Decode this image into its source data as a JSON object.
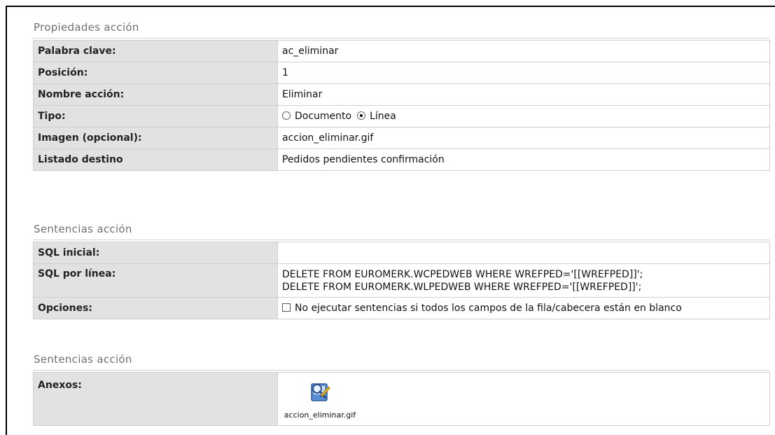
{
  "sections": {
    "properties_title": "Propiedades acción",
    "sentences_title": "Sentencias acción",
    "attachments_title": "Sentencias acción"
  },
  "properties": {
    "keyword_label": "Palabra clave:",
    "keyword_value": "ac_eliminar",
    "position_label": "Posición:",
    "position_value": "1",
    "name_label": "Nombre acción:",
    "name_value": "Eliminar",
    "type_label": "Tipo:",
    "type_option_document": "Documento",
    "type_option_line": "Línea",
    "type_selected": "Línea",
    "image_label": "Imagen (opcional):",
    "image_value": "accion_eliminar.gif",
    "target_label": "Listado destino",
    "target_value": "Pedidos pendientes confirmación"
  },
  "sentences": {
    "initial_label": "SQL inicial:",
    "initial_value": "",
    "per_line_label": "SQL por línea:",
    "per_line_value_1": "DELETE FROM EUROMERK.WCPEDWEB WHERE WREFPED='[[WREFPED]]';",
    "per_line_value_2": "DELETE FROM EUROMERK.WLPEDWEB WHERE WREFPED='[[WREFPED]]';",
    "options_label": "Opciones:",
    "options_checkbox_label": "No ejecutar sentencias si todos los campos de la fila/cabecera están en blanco",
    "options_checked": false
  },
  "attachments": {
    "label": "Anexos:",
    "file_name": "accion_eliminar.gif",
    "file_icon": "image-file-icon"
  }
}
